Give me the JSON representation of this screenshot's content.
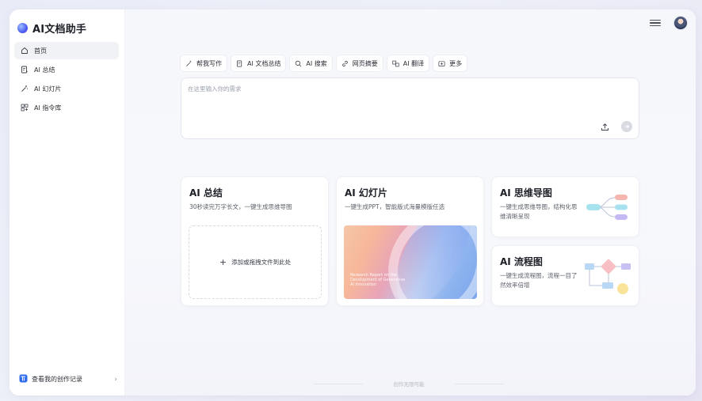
{
  "app": {
    "name": "AI文档助手"
  },
  "nav": {
    "items": [
      {
        "label": "首页",
        "icon": "home-icon",
        "active": true
      },
      {
        "label": "AI 总结",
        "icon": "summary-icon"
      },
      {
        "label": "AI 幻灯片",
        "icon": "magic-wand-icon"
      },
      {
        "label": "AI 指令库",
        "icon": "grid-icon"
      }
    ]
  },
  "history": {
    "label": "查看我的创作记录"
  },
  "tools": [
    {
      "label": "帮我写作",
      "icon": "magic-pen-icon"
    },
    {
      "label": "AI 文档总结",
      "icon": "document-icon"
    },
    {
      "label": "AI 搜索",
      "icon": "search-icon"
    },
    {
      "label": "网页摘要",
      "icon": "link-icon"
    },
    {
      "label": "AI 翻译",
      "icon": "translate-icon"
    },
    {
      "label": "更多",
      "icon": "more-icon"
    }
  ],
  "prompt": {
    "placeholder": "在这里输入你的需求"
  },
  "cards": {
    "summary": {
      "title": "AI 总结",
      "desc": "30秒读完万字长文，一键生成思维导图",
      "drop_label": "添加或拖拽文件到此处"
    },
    "slides": {
      "title": "AI 幻灯片",
      "desc": "一键生成PPT，智能版式海量模版任选",
      "thumb_title": "Research Report on the Development of Generative AI Innovation"
    },
    "mindmap": {
      "title": "AI 思维导图",
      "desc": "一键生成思维导图，结构化思维清晰呈现"
    },
    "flowchart": {
      "title": "AI 流程图",
      "desc": "一键生成流程图，流程一目了然效率倍增"
    }
  },
  "footer": {
    "hint": "创作无限可能"
  },
  "colors": {
    "accent": "#4b5df0",
    "mindmap_nodes": [
      "#f6b6b0",
      "#a7e3ee",
      "#c4b8f5"
    ],
    "flow_nodes": [
      "#b9d8f5",
      "#f7bfc3",
      "#c8c1f4",
      "#f9e49a"
    ]
  }
}
